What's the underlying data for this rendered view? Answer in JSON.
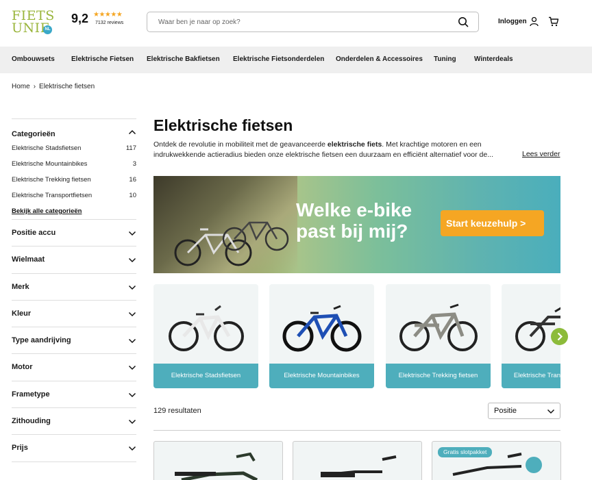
{
  "header": {
    "logo_line1": "FIETS",
    "logo_line2": "UNIE",
    "logo_badge": "NL",
    "rating_score": "9,2",
    "rating_stars": "★★★★★",
    "rating_reviews": "7132 reviews",
    "search_placeholder": "Waar ben je naar op zoek?",
    "login_label": "Inloggen"
  },
  "nav": {
    "items": [
      "Ombouwsets",
      "Elektrische Fietsen",
      "Elektrische Bakfietsen",
      "Elektrische Fietsonderdelen",
      "Onderdelen & Accessoires",
      "Tuning",
      "Winterdeals"
    ]
  },
  "breadcrumb": {
    "home": "Home",
    "current": "Elektrische fietsen"
  },
  "sidebar": {
    "categories_title": "Categorieën",
    "categories": [
      {
        "label": "Elektrische Stadsfietsen",
        "count": "117"
      },
      {
        "label": "Elektrische Mountainbikes",
        "count": "3"
      },
      {
        "label": "Elektrische Trekking fietsen",
        "count": "16"
      },
      {
        "label": "Elektrische Transportfietsen",
        "count": "10"
      }
    ],
    "all_categories": "Bekijk alle categorieën",
    "filters": [
      "Positie accu",
      "Wielmaat",
      "Merk",
      "Kleur",
      "Type aandrijving",
      "Motor",
      "Frametype",
      "Zithouding",
      "Prijs"
    ]
  },
  "main": {
    "title": "Elektrische fietsen",
    "intro_before": "Ontdek de revolutie in mobiliteit met de geavanceerde ",
    "intro_bold": "elektrische fiets",
    "intro_after": ". Met krachtige motoren en een indrukwekkende actieradius bieden onze elektrische fietsen een duurzaam en efficiënt alternatief voor de...",
    "read_more": "Lees verder",
    "banner_line1": "Welke e-bike",
    "banner_line2": "past bij mij?",
    "banner_cta": "Start keuzehulp  >",
    "category_cards": [
      "Elektrische Stadsfietsen",
      "Elektrische Mountainbikes",
      "Elektrische Trekking fietsen",
      "Elektrische Transportfietsen"
    ],
    "results_count": "129 resultaten",
    "sort_value": "Positie",
    "product_badge": "Gratis slotpakket"
  },
  "colors": {
    "accent_green": "#8cbb3a",
    "accent_teal": "#4eaebc",
    "cta_orange": "#f5a623",
    "nav_bg": "#efefef"
  }
}
